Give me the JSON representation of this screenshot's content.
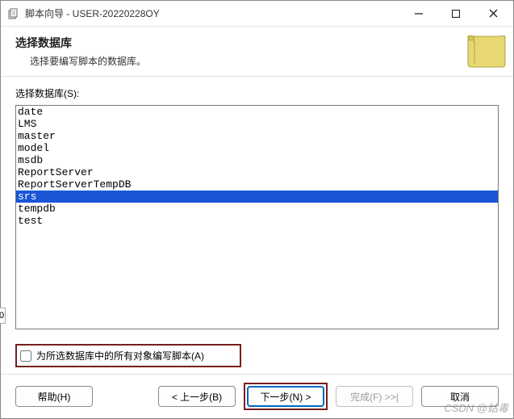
{
  "window": {
    "title": "脚本向导 - USER-20220228OY"
  },
  "header": {
    "title": "选择数据库",
    "description": "选择要编写脚本的数据库。"
  },
  "content": {
    "list_label": "选择数据库(S):",
    "databases": [
      {
        "name": "date",
        "selected": false
      },
      {
        "name": "LMS",
        "selected": false
      },
      {
        "name": "master",
        "selected": false
      },
      {
        "name": "model",
        "selected": false
      },
      {
        "name": "msdb",
        "selected": false
      },
      {
        "name": "ReportServer",
        "selected": false
      },
      {
        "name": "ReportServerTempDB",
        "selected": false
      },
      {
        "name": "srs",
        "selected": true
      },
      {
        "name": "tempdb",
        "selected": false
      },
      {
        "name": "test",
        "selected": false
      }
    ],
    "checkbox_label": "为所选数据库中的所有对象编写脚本(A)",
    "checkbox_checked": false
  },
  "footer": {
    "help": "帮助(H)",
    "back": "< 上一步(B)",
    "next": "下一步(N) >",
    "finish": "完成(F) >>|",
    "cancel": "取消"
  },
  "watermark": "CSDN @姑毒"
}
